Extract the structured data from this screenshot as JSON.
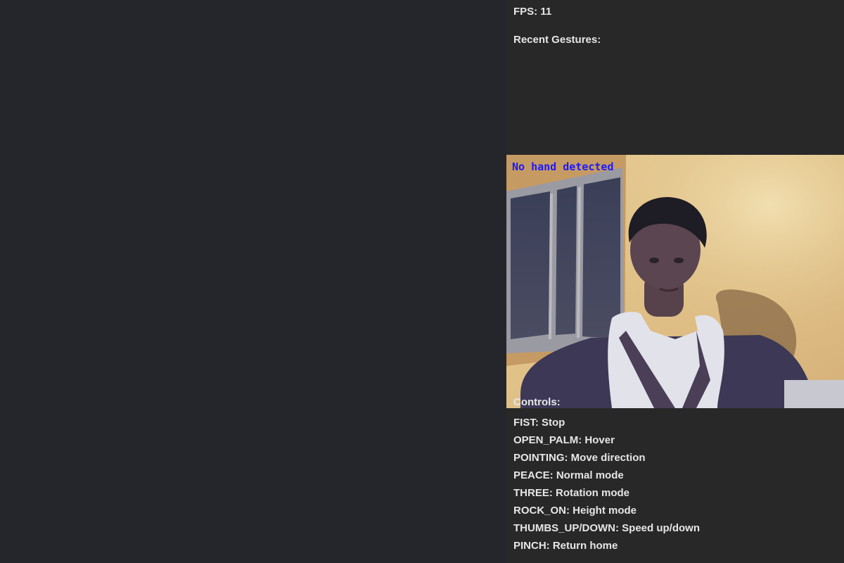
{
  "status": {
    "fps_label": "FPS: 11",
    "recent_gestures_label": "Recent Gestures:"
  },
  "camera": {
    "detection_text": "No hand detected"
  },
  "controls": {
    "title": "Controls:",
    "items": [
      "FIST: Stop",
      "OPEN_PALM: Hover",
      "POINTING: Move direction",
      "PEACE: Normal mode",
      "THREE: Rotation mode",
      "ROCK_ON: Height mode",
      "THUMBS_UP/DOWN: Speed up/down",
      "PINCH: Return home"
    ]
  },
  "colors": {
    "viewport_bg": "#25252c",
    "panel_bg": "#282828",
    "text": "#e6e6e6",
    "detection_text": "#1a1aff"
  }
}
